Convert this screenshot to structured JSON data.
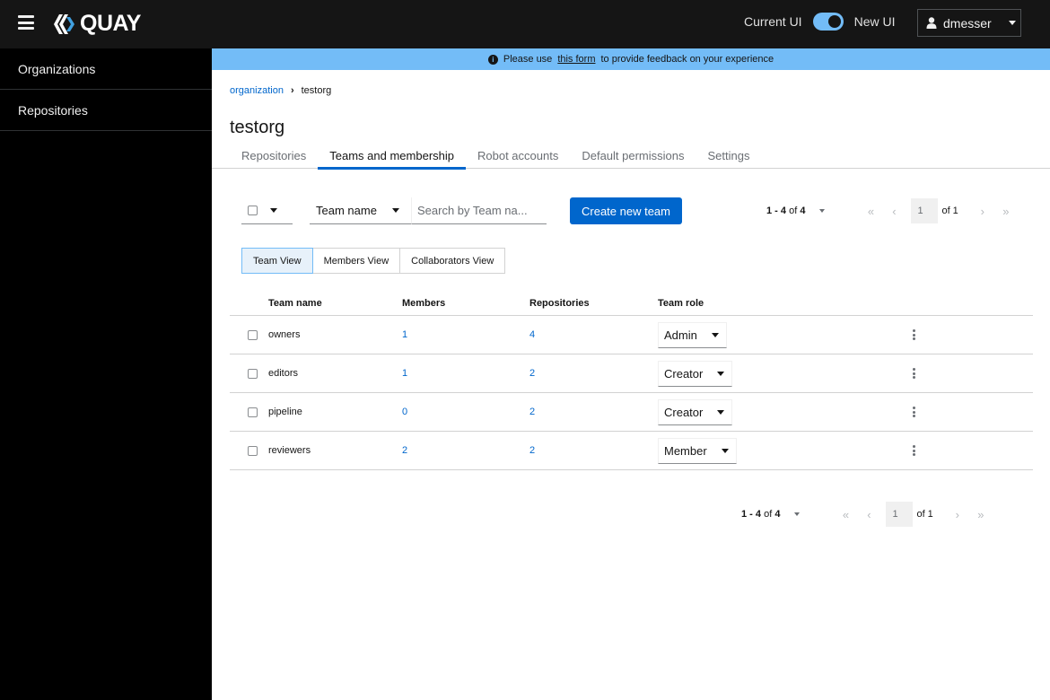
{
  "masthead": {
    "logo_text": "QUAY",
    "toggle_left_label": "Current UI",
    "toggle_right_label": "New UI",
    "toggle_on": true,
    "username": "dmesser"
  },
  "sidebar": {
    "items": [
      {
        "label": "Organizations"
      },
      {
        "label": "Repositories"
      }
    ]
  },
  "banner": {
    "prefix": "Please use",
    "link": "this form",
    "suffix": "to provide feedback on your experience"
  },
  "breadcrumb": {
    "parent": "organization",
    "current": "testorg"
  },
  "page": {
    "title": "testorg"
  },
  "tabs": [
    {
      "label": "Repositories",
      "active": false
    },
    {
      "label": "Teams and membership",
      "active": true
    },
    {
      "label": "Robot accounts",
      "active": false
    },
    {
      "label": "Default permissions",
      "active": false
    },
    {
      "label": "Settings",
      "active": false
    }
  ],
  "toolbar": {
    "filter_selected": "Team name",
    "search_placeholder": "Search by Team na...",
    "create_label": "Create new team"
  },
  "pagination": {
    "range_start_end": "1 - 4",
    "range_of": "of",
    "total": "4",
    "current_page": "1",
    "of_pages": "of 1",
    "first_icon": "«",
    "prev_icon": "‹",
    "next_icon": "›",
    "last_icon": "»"
  },
  "view_toggle": [
    {
      "label": "Team View",
      "active": true
    },
    {
      "label": "Members View",
      "active": false
    },
    {
      "label": "Collaborators View",
      "active": false
    }
  ],
  "table": {
    "columns": [
      "Team name",
      "Members",
      "Repositories",
      "Team role"
    ],
    "rows": [
      {
        "name": "owners",
        "members": "1",
        "repositories": "4",
        "role": "Admin"
      },
      {
        "name": "editors",
        "members": "1",
        "repositories": "2",
        "role": "Creator"
      },
      {
        "name": "pipeline",
        "members": "0",
        "repositories": "2",
        "role": "Creator"
      },
      {
        "name": "reviewers",
        "members": "2",
        "repositories": "2",
        "role": "Member"
      }
    ]
  },
  "colors": {
    "masthead_bg": "#151515",
    "sidebar_bg": "#000000",
    "banner_bg": "#73bcf7",
    "primary": "#0066cc"
  }
}
